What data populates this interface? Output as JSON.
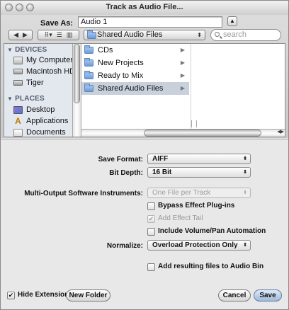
{
  "window": {
    "title": "Track as Audio File..."
  },
  "save_as": {
    "label": "Save As:",
    "value": "Audio 1",
    "expand_icon": "triangle-up-icon"
  },
  "toolbar": {
    "back_icon": "back-arrow-icon",
    "forward_icon": "forward-arrow-icon",
    "view_menu_icon": "view-options-icon",
    "list_view_icon": "list-view-icon",
    "column_view_icon": "column-view-icon",
    "location": "Shared Audio Files",
    "search_placeholder": "search"
  },
  "sidebar": {
    "devices_header": "DEVICES",
    "devices": [
      {
        "label": "My Computer",
        "icon": "computer-icon"
      },
      {
        "label": "Macintosh HD",
        "icon": "hard-disk-icon"
      },
      {
        "label": "Tiger",
        "icon": "hard-disk-icon"
      }
    ],
    "places_header": "PLACES",
    "places": [
      {
        "label": "Desktop",
        "icon": "desktop-icon"
      },
      {
        "label": "Applications",
        "icon": "applications-icon"
      },
      {
        "label": "Documents",
        "icon": "documents-icon"
      }
    ]
  },
  "column1": {
    "items": [
      {
        "label": "CDs",
        "selected": false
      },
      {
        "label": "New Projects",
        "selected": false
      },
      {
        "label": "Ready to Mix",
        "selected": false
      },
      {
        "label": "Shared Audio Files",
        "selected": true
      }
    ]
  },
  "options": {
    "save_format": {
      "label": "Save Format:",
      "value": "AIFF"
    },
    "bit_depth": {
      "label": "Bit Depth:",
      "value": "16 Bit"
    },
    "multi_output": {
      "label": "Multi-Output Software Instruments:",
      "value": "One File per Track",
      "enabled": false
    },
    "bypass_effect": {
      "label": "Bypass Effect Plug-ins",
      "checked": false
    },
    "add_effect_tail": {
      "label": "Add Effect Tail",
      "checked": true,
      "enabled": false
    },
    "include_automation": {
      "label": "Include Volume/Pan Automation",
      "checked": false
    },
    "normalize": {
      "label": "Normalize:",
      "value": "Overload Protection Only"
    },
    "add_to_bin": {
      "label": "Add resulting files to Audio Bin",
      "checked": false
    }
  },
  "footer": {
    "hide_extension": {
      "label": "Hide Extension",
      "checked": true
    },
    "new_folder": "New Folder",
    "cancel": "Cancel",
    "save": "Save"
  },
  "colors": {
    "selection": "#c8d0dc",
    "sidebar_bg": "#e3e8ef",
    "default_button": "#9fb8d9"
  }
}
